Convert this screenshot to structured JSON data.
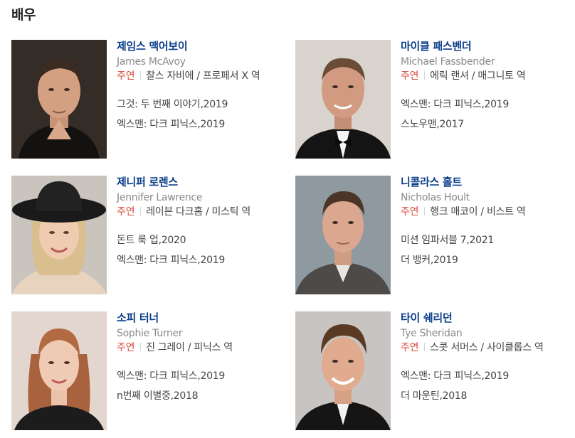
{
  "section": {
    "title": "배우"
  },
  "role_badge": "주연",
  "actors": [
    {
      "name": "제임스 맥어보이",
      "english_name": "James McAvoy",
      "role": "찰스 자비에 / 프로페서 X 역",
      "films": [
        "그것: 두 번째 이야기,2019",
        "엑스맨: 다크 피닉스,2019"
      ]
    },
    {
      "name": "마이클 패스벤더",
      "english_name": "Michael Fassbender",
      "role": "에릭 랜셔 / 매그니토 역",
      "films": [
        "엑스맨: 다크 피닉스,2019",
        "스노우맨,2017"
      ]
    },
    {
      "name": "제니퍼 로렌스",
      "english_name": "Jennifer Lawrence",
      "role": "레이븐 다크홈 / 미스틱 역",
      "films": [
        "돈트 룩 업,2020",
        "엑스맨: 다크 피닉스,2019"
      ]
    },
    {
      "name": "니콜라스 홀트",
      "english_name": "Nicholas Hoult",
      "role": "행크 매코이 / 비스트 역",
      "films": [
        "미션 임파서블 7,2021",
        "더 뱅커,2019"
      ]
    },
    {
      "name": "소피 터너",
      "english_name": "Sophie Turner",
      "role": "진 그레이 / 피닉스 역",
      "films": [
        "엑스맨: 다크 피닉스,2019",
        "n번째 이별중,2018"
      ]
    },
    {
      "name": "타이 쉐리던",
      "english_name": "Tye Sheridan",
      "role": "스콧 서머스 / 사이클롭스 역",
      "films": [
        "엑스맨: 다크 피닉스,2019",
        "더 마운틴,2018"
      ]
    }
  ]
}
